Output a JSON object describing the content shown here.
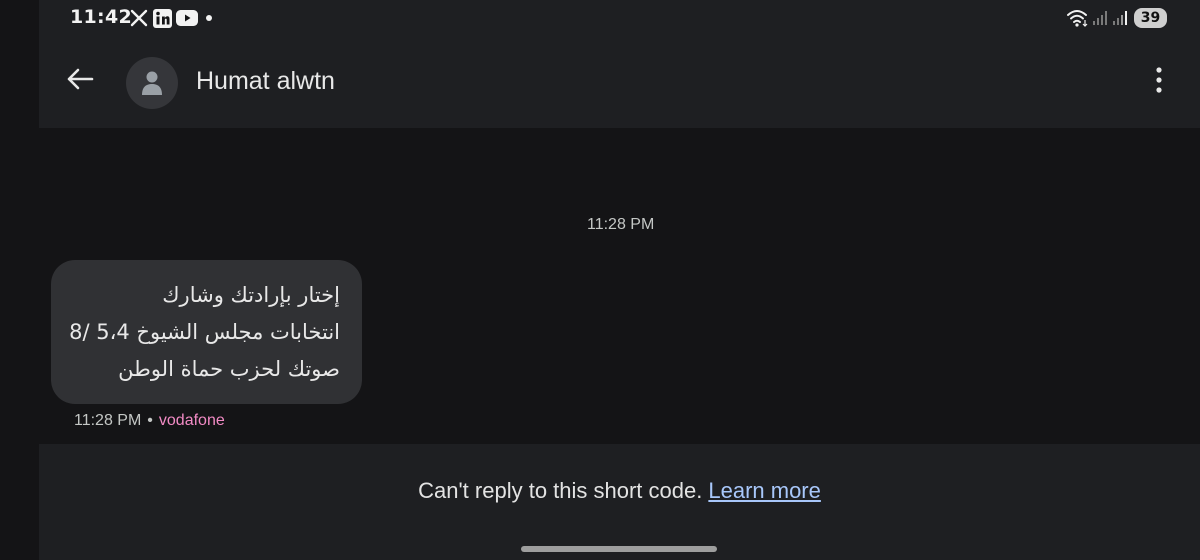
{
  "status_bar": {
    "time": "11:42",
    "notification_icons": [
      "x-icon",
      "linkedin-icon",
      "youtube-icon",
      "dot-icon"
    ],
    "system_icons": [
      "wifi-icon",
      "signal-icon",
      "signal-icon"
    ],
    "battery_level": "39"
  },
  "app_bar": {
    "back_icon": "arrow-back-icon",
    "avatar_icon": "person-icon",
    "contact_name": "Humat alwtn",
    "menu_icon": "more-vert-icon"
  },
  "conversation": {
    "date_stamp": "11:28 PM",
    "messages": [
      {
        "lines": [
          "إختار بإرادتك وشارك",
          "انتخابات مجلس الشيوخ 5،4 /8",
          "صوتك لحزب حماة الوطن"
        ],
        "time": "11:28 PM",
        "separator": "•",
        "carrier": "vodafone"
      }
    ]
  },
  "footer": {
    "notice_text": "Can't reply to this short code.",
    "learn_more_label": "Learn more"
  },
  "colors": {
    "background": "#141416",
    "surface": "#1e1f22",
    "bubble": "#303134",
    "link": "#a8c7fa",
    "carrier": "#f28bc5"
  }
}
